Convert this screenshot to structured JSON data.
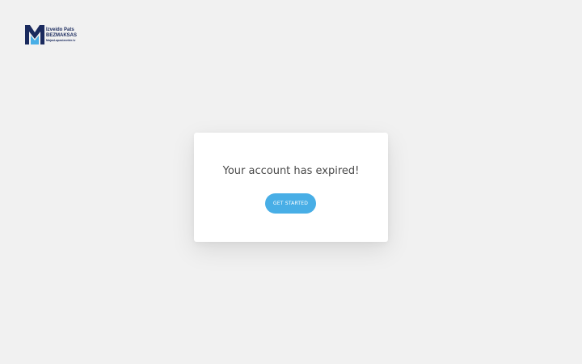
{
  "brand": {
    "line1": "Izveido Pats",
    "line2": "BEZMAKSAS",
    "line3": "MajasLapasIzveide.lv",
    "colors": {
      "navy": "#1a2a5e",
      "accent": "#48aee6"
    }
  },
  "dialog": {
    "title": "Your account has expired!",
    "cta_label": "GET STARTED"
  },
  "colors": {
    "background": "#f1f1f1",
    "card": "#ffffff",
    "button": "#48aee6",
    "title_text": "#4a4a4a"
  }
}
